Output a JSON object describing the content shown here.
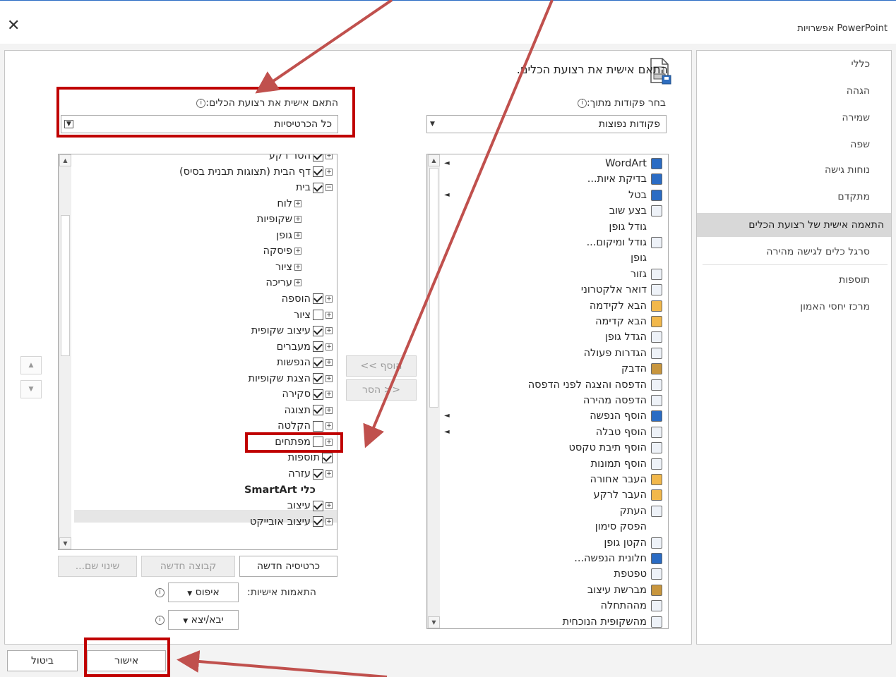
{
  "window": {
    "title": "אפשרויות PowerPoint",
    "close_icon": "close-icon"
  },
  "nav": {
    "items": [
      {
        "label": "כללי",
        "selected": false
      },
      {
        "label": "הגהה",
        "selected": false
      },
      {
        "label": "שמירה",
        "selected": false
      },
      {
        "label": "שפה",
        "selected": false
      },
      {
        "label": "נוחות גישה",
        "selected": false
      },
      {
        "label": "מתקדם",
        "selected": false
      },
      {
        "label": "התאמה אישית של רצועת הכלים",
        "selected": true
      },
      {
        "label": "סרגל כלים לגישה מהירה",
        "selected": false
      },
      {
        "label": "תוספות",
        "selected": false
      },
      {
        "label": "מרכז יחסי האמון",
        "selected": false
      }
    ]
  },
  "main": {
    "heading": "התאם אישית את רצועת הכלים.",
    "choose_label": "בחר פקודות מתוך:",
    "choose_value": "פקודות נפוצות",
    "customize_label": "התאם אישית את רצועת הכלים:",
    "customize_value": "כל הכרטיסיות",
    "commands": [
      {
        "label": "WordArt",
        "icon": "wordart-icon",
        "submenu": true
      },
      {
        "label": "בדיקת איות...",
        "icon": "spelling-icon",
        "submenu": false
      },
      {
        "label": "בטל",
        "icon": "undo-icon",
        "submenu": true
      },
      {
        "label": "בצע שוב",
        "icon": "redo-icon",
        "submenu": false
      },
      {
        "label": "גודל גופן",
        "icon": "",
        "submenu": false
      },
      {
        "label": "גודל ומיקום...",
        "icon": "size-position-icon",
        "submenu": false
      },
      {
        "label": "גופן",
        "icon": "",
        "submenu": false
      },
      {
        "label": "גזור",
        "icon": "cut-icon",
        "submenu": false
      },
      {
        "label": "דואר אלקטרוני",
        "icon": "email-icon",
        "submenu": false
      },
      {
        "label": "הבא לקידמה",
        "icon": "bring-forward-icon",
        "submenu": false
      },
      {
        "label": "הבא קדימה",
        "icon": "bring-front-icon",
        "submenu": false
      },
      {
        "label": "הגדל גופן",
        "icon": "grow-font-icon",
        "submenu": false
      },
      {
        "label": "הגדרות פעולה",
        "icon": "action-icon",
        "submenu": false
      },
      {
        "label": "הדבק",
        "icon": "paste-icon",
        "submenu": false
      },
      {
        "label": "הדפסה והצגה לפני הדפסה",
        "icon": "print-preview-icon",
        "submenu": false
      },
      {
        "label": "הדפסה מהירה",
        "icon": "quick-print-icon",
        "submenu": false
      },
      {
        "label": "הוסף הנפשה",
        "icon": "add-animation-icon",
        "submenu": true
      },
      {
        "label": "הוסף טבלה",
        "icon": "table-icon",
        "submenu": true
      },
      {
        "label": "הוסף תיבת טקסט",
        "icon": "textbox-icon",
        "submenu": false
      },
      {
        "label": "הוסף תמונות",
        "icon": "pictures-icon",
        "submenu": false
      },
      {
        "label": "העבר אחורה",
        "icon": "send-backward-icon",
        "submenu": false
      },
      {
        "label": "העבר לרקע",
        "icon": "send-back-icon",
        "submenu": false
      },
      {
        "label": "העתק",
        "icon": "copy-icon",
        "submenu": false
      },
      {
        "label": "הפסק סימון",
        "icon": "",
        "submenu": false
      },
      {
        "label": "הקטן גופן",
        "icon": "shrink-font-icon",
        "submenu": false
      },
      {
        "label": "חלונית הנפשה...",
        "icon": "animation-pane-icon",
        "submenu": false
      },
      {
        "label": "טפטפת",
        "icon": "eyedropper-icon",
        "submenu": false
      },
      {
        "label": "מברשת עיצוב",
        "icon": "format-painter-icon",
        "submenu": false
      },
      {
        "label": "מההתחלה",
        "icon": "from-beginning-icon",
        "submenu": false
      },
      {
        "label": "מהשקופית הנוכחית",
        "icon": "from-current-icon",
        "submenu": false
      }
    ],
    "tree": [
      {
        "label": "הסר רקע",
        "level": 0,
        "expander": "+",
        "checkbox": "on"
      },
      {
        "label": "דף הבית (תצוגות תבנית בסיס)",
        "level": 0,
        "expander": "+",
        "checkbox": "on"
      },
      {
        "label": "בית",
        "level": 0,
        "expander": "-",
        "checkbox": "on"
      },
      {
        "label": "לוח",
        "level": 1,
        "expander": "+",
        "checkbox": "none"
      },
      {
        "label": "שקופיות",
        "level": 1,
        "expander": "+",
        "checkbox": "none"
      },
      {
        "label": "גופן",
        "level": 1,
        "expander": "+",
        "checkbox": "none"
      },
      {
        "label": "פיסקה",
        "level": 1,
        "expander": "+",
        "checkbox": "none"
      },
      {
        "label": "ציור",
        "level": 1,
        "expander": "+",
        "checkbox": "none"
      },
      {
        "label": "עריכה",
        "level": 1,
        "expander": "+",
        "checkbox": "none"
      },
      {
        "label": "הוספה",
        "level": 0,
        "expander": "+",
        "checkbox": "on"
      },
      {
        "label": "ציור",
        "level": 0,
        "expander": "+",
        "checkbox": "off"
      },
      {
        "label": "עיצוב שקופית",
        "level": 0,
        "expander": "+",
        "checkbox": "on"
      },
      {
        "label": "מעברים",
        "level": 0,
        "expander": "+",
        "checkbox": "on"
      },
      {
        "label": "הנפשות",
        "level": 0,
        "expander": "+",
        "checkbox": "on"
      },
      {
        "label": "הצגת שקופיות",
        "level": 0,
        "expander": "+",
        "checkbox": "on"
      },
      {
        "label": "סקירה",
        "level": 0,
        "expander": "+",
        "checkbox": "on"
      },
      {
        "label": "תצוגה",
        "level": 0,
        "expander": "+",
        "checkbox": "on"
      },
      {
        "label": "הקלטה",
        "level": 0,
        "expander": "+",
        "checkbox": "off"
      },
      {
        "label": "מפתחים",
        "level": 0,
        "expander": "+",
        "checkbox": "off"
      },
      {
        "label": "תוספות",
        "level": 0,
        "expander": "",
        "checkbox": "on"
      },
      {
        "label": "עזרה",
        "level": 0,
        "expander": "+",
        "checkbox": "on"
      },
      {
        "label": "כלי SmartArt",
        "level": -1,
        "expander": "",
        "checkbox": "none"
      },
      {
        "label": "עיצוב",
        "level": 0,
        "expander": "+",
        "checkbox": "on"
      },
      {
        "label": "עיצוב אובייקט",
        "level": 0,
        "expander": "+",
        "checkbox": "on"
      }
    ],
    "add_button": "הוסף >>",
    "remove_button": "<< הסר",
    "new_tab_button": "כרטיסיה חדשה",
    "new_group_button": "קבוצה חדשה",
    "rename_button": "שינוי שם...",
    "customizations_label": "התאמות אישיות:",
    "reset_label": "איפוס",
    "import_export_label": "יבא/יצא",
    "ok_button": "אישור",
    "cancel_button": "ביטול"
  },
  "colors": {
    "annotation": "#c00000",
    "arrow": "#c0504d"
  }
}
